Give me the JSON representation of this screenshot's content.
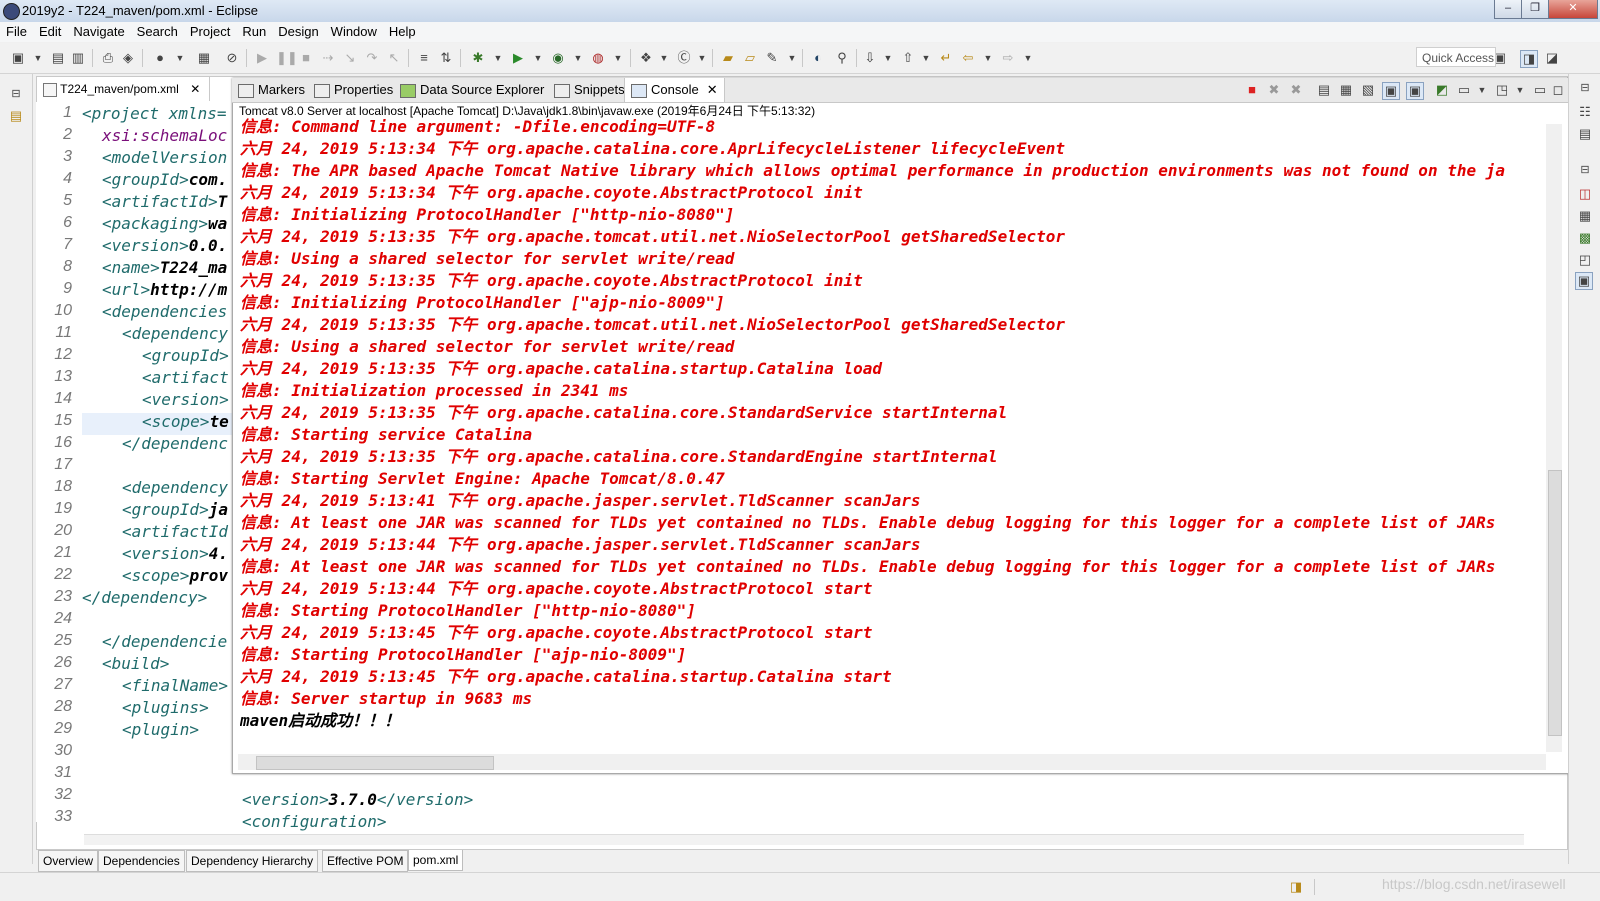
{
  "window": {
    "title": "2019y2 - T224_maven/pom.xml - Eclipse",
    "controls": [
      "–",
      "❐",
      "✕"
    ]
  },
  "menu": [
    "File",
    "Edit",
    "Navigate",
    "Search",
    "Project",
    "Run",
    "Design",
    "Window",
    "Help"
  ],
  "toolbar": {
    "quick_access": "Quick Access"
  },
  "editor": {
    "tab_label": "T224_maven/pom.xml",
    "line_numbers": [
      "1",
      "2",
      "3",
      "4",
      "5",
      "6",
      "7",
      "8",
      "9",
      "10",
      "11",
      "12",
      "13",
      "14",
      "15",
      "16",
      "17",
      "18",
      "19",
      "20",
      "21",
      "22",
      "23",
      "24",
      "25",
      "26",
      "27",
      "28",
      "29",
      "30",
      "31",
      "32",
      "33"
    ],
    "lines": [
      [
        "<project xmlns=",
        ""
      ],
      [
        "xsi:schemaLoc",
        ""
      ],
      [
        "<modelVersion",
        ""
      ],
      [
        "<groupId>",
        "com."
      ],
      [
        "<artifactId>",
        "T"
      ],
      [
        "<packaging>",
        "wa"
      ],
      [
        "<version>",
        "0.0."
      ],
      [
        "<name>",
        "T224_ma"
      ],
      [
        "<url>",
        "http://m"
      ],
      [
        "<dependencies",
        ""
      ],
      [
        "<dependency",
        ""
      ],
      [
        "<groupId>",
        ""
      ],
      [
        "<artifact",
        ""
      ],
      [
        "<version>",
        ""
      ],
      [
        "<scope>",
        "te"
      ],
      [
        "</dependenc",
        ""
      ],
      [
        "",
        ""
      ],
      [
        "<dependency",
        ""
      ],
      [
        "<groupId>",
        "ja"
      ],
      [
        "<artifactId",
        ""
      ],
      [
        "<version>",
        "4."
      ],
      [
        "<scope>",
        "prov"
      ],
      [
        "</dependency>",
        ""
      ],
      [
        "",
        ""
      ],
      [
        "</dependencie",
        ""
      ],
      [
        "<build>",
        ""
      ],
      [
        "<finalName>",
        ""
      ],
      [
        "<plugins>",
        ""
      ],
      [
        "<plugin>",
        ""
      ],
      [
        "",
        ""
      ],
      [
        "",
        ""
      ],
      [
        "<version>",
        "3.7.0"
      ],
      [
        "<configuration>",
        ""
      ]
    ],
    "line32_close": "</version>",
    "bottom_tabs": [
      "Overview",
      "Dependencies",
      "Dependency Hierarchy",
      "Effective POM",
      "pom.xml"
    ]
  },
  "console": {
    "tabs": [
      "Markers",
      "Properties",
      "Data Source Explorer",
      "Snippets",
      "Console"
    ],
    "header": "Tomcat v8.0 Server at localhost [Apache Tomcat] D:\\Java\\jdk1.8\\bin\\javaw.exe (2019年6月24日 下午5:13:32)",
    "lines": [
      "信息: Command line argument: -Dfile.encoding=UTF-8",
      "六月 24, 2019 5:13:34 下午 org.apache.catalina.core.AprLifecycleListener lifecycleEvent",
      "信息: The APR based Apache Tomcat Native library which allows optimal performance in production environments was not found on the ja",
      "六月 24, 2019 5:13:34 下午 org.apache.coyote.AbstractProtocol init",
      "信息: Initializing ProtocolHandler [\"http-nio-8080\"]",
      "六月 24, 2019 5:13:35 下午 org.apache.tomcat.util.net.NioSelectorPool getSharedSelector",
      "信息: Using a shared selector for servlet write/read",
      "六月 24, 2019 5:13:35 下午 org.apache.coyote.AbstractProtocol init",
      "信息: Initializing ProtocolHandler [\"ajp-nio-8009\"]",
      "六月 24, 2019 5:13:35 下午 org.apache.tomcat.util.net.NioSelectorPool getSharedSelector",
      "信息: Using a shared selector for servlet write/read",
      "六月 24, 2019 5:13:35 下午 org.apache.catalina.startup.Catalina load",
      "信息: Initialization processed in 2341 ms",
      "六月 24, 2019 5:13:35 下午 org.apache.catalina.core.StandardService startInternal",
      "信息: Starting service Catalina",
      "六月 24, 2019 5:13:35 下午 org.apache.catalina.core.StandardEngine startInternal",
      "信息: Starting Servlet Engine: Apache Tomcat/8.0.47",
      "六月 24, 2019 5:13:41 下午 org.apache.jasper.servlet.TldScanner scanJars",
      "信息: At least one JAR was scanned for TLDs yet contained no TLDs. Enable debug logging for this logger for a complete list of JARs",
      "六月 24, 2019 5:13:44 下午 org.apache.jasper.servlet.TldScanner scanJars",
      "信息: At least one JAR was scanned for TLDs yet contained no TLDs. Enable debug logging for this logger for a complete list of JARs",
      "六月 24, 2019 5:13:44 下午 org.apache.coyote.AbstractProtocol start",
      "信息: Starting ProtocolHandler [\"http-nio-8080\"]",
      "六月 24, 2019 5:13:45 下午 org.apache.coyote.AbstractProtocol start",
      "信息: Starting ProtocolHandler [\"ajp-nio-8009\"]",
      "六月 24, 2019 5:13:45 下午 org.apache.catalina.startup.Catalina start",
      "信息: Server startup in 9683 ms",
      "maven启动成功！！！"
    ]
  },
  "status": {
    "watermark": "https://blog.csdn.net/irasewell"
  },
  "colors": {
    "console_error": "#e00000",
    "xml_tag": "#1f6b6b",
    "xml_attr": "#7a0f7a"
  }
}
